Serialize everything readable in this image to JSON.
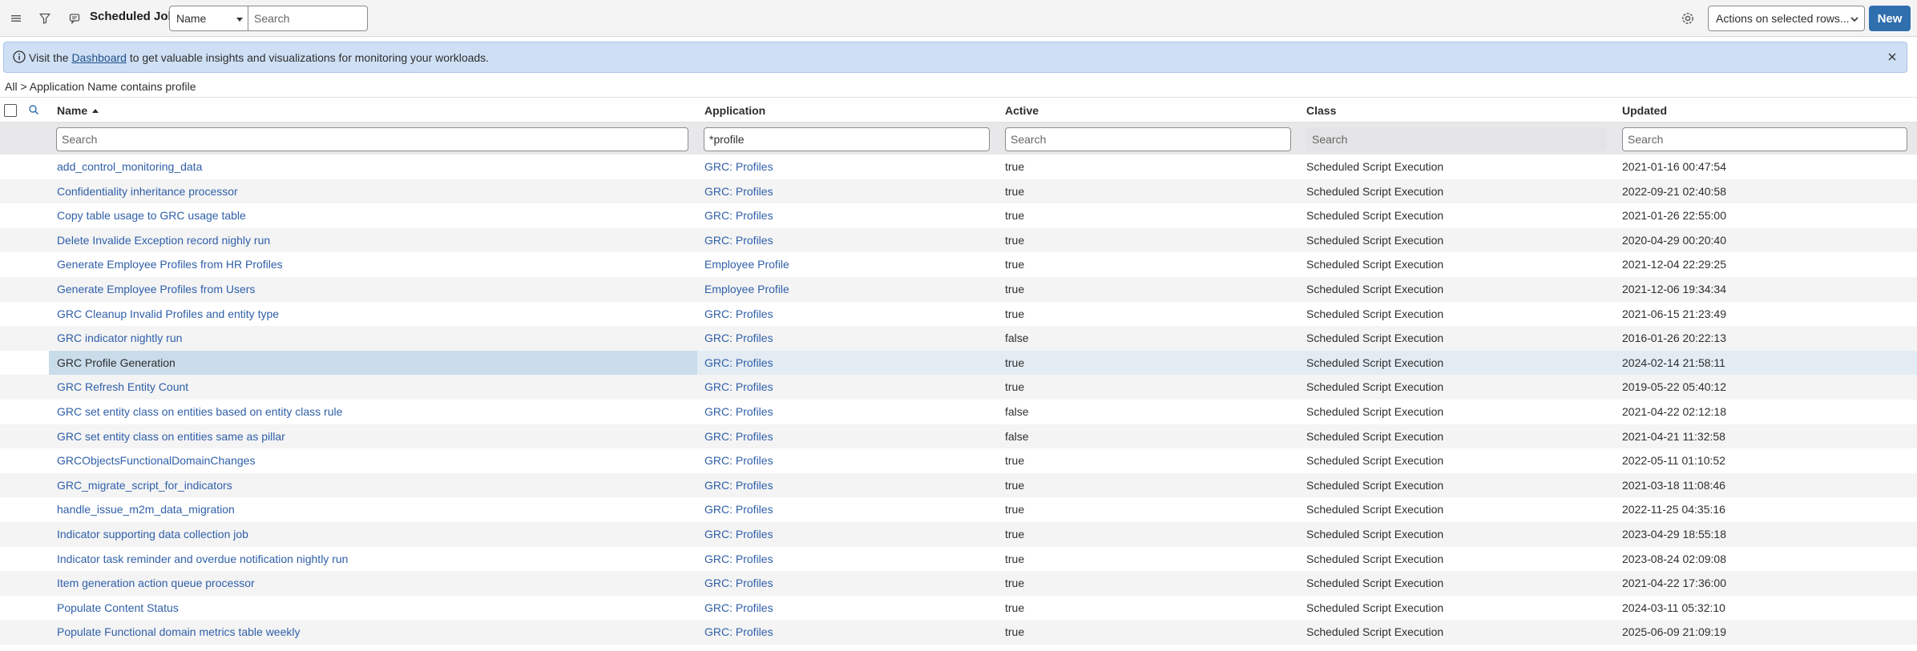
{
  "header": {
    "title": "Scheduled Jobs",
    "field_select": "Name",
    "search_placeholder": "Search",
    "actions_select": "Actions on selected rows...",
    "new_label": "New",
    "icons": [
      "hamburger-icon",
      "filter-icon",
      "chat-icon",
      "settings-icon"
    ]
  },
  "banner": {
    "prefix": "Visit the ",
    "link": "Dashboard",
    "suffix": " to get valuable insights and visualizations for monitoring your workloads."
  },
  "breadcrumb": "All > Application Name contains profile",
  "table": {
    "columns": {
      "name": "Name",
      "application": "Application",
      "active": "Active",
      "class": "Class",
      "updated": "Updated"
    },
    "filters": {
      "name_placeholder": "Search",
      "application_value": "*profile",
      "active_placeholder": "Search",
      "class_placeholder": "Search",
      "updated_placeholder": "Search"
    },
    "rows": [
      {
        "name": "add_control_monitoring_data",
        "application": "GRC: Profiles",
        "active": "true",
        "class": "Scheduled Script Execution",
        "updated": "2021-01-16 00:47:54"
      },
      {
        "name": "Confidentiality inheritance processor",
        "application": "GRC: Profiles",
        "active": "true",
        "class": "Scheduled Script Execution",
        "updated": "2022-09-21 02:40:58"
      },
      {
        "name": "Copy table usage to GRC usage table",
        "application": "GRC: Profiles",
        "active": "true",
        "class": "Scheduled Script Execution",
        "updated": "2021-01-26 22:55:00"
      },
      {
        "name": "Delete Invalide Exception record nighly run",
        "application": "GRC: Profiles",
        "active": "true",
        "class": "Scheduled Script Execution",
        "updated": "2020-04-29 00:20:40"
      },
      {
        "name": "Generate Employee Profiles from HR Profiles",
        "application": "Employee Profile",
        "active": "true",
        "class": "Scheduled Script Execution",
        "updated": "2021-12-04 22:29:25"
      },
      {
        "name": "Generate Employee Profiles from Users",
        "application": "Employee Profile",
        "active": "true",
        "class": "Scheduled Script Execution",
        "updated": "2021-12-06 19:34:34"
      },
      {
        "name": "GRC Cleanup Invalid Profiles and entity type",
        "application": "GRC: Profiles",
        "active": "true",
        "class": "Scheduled Script Execution",
        "updated": "2021-06-15 21:23:49"
      },
      {
        "name": "GRC indicator nightly run",
        "application": "GRC: Profiles",
        "active": "false",
        "class": "Scheduled Script Execution",
        "updated": "2016-01-26 20:22:13"
      },
      {
        "name": "GRC Profile Generation",
        "application": "GRC: Profiles",
        "active": "true",
        "class": "Scheduled Script Execution",
        "updated": "2024-02-14 21:58:11",
        "selected": true
      },
      {
        "name": "GRC Refresh Entity Count",
        "application": "GRC: Profiles",
        "active": "true",
        "class": "Scheduled Script Execution",
        "updated": "2019-05-22 05:40:12"
      },
      {
        "name": "GRC set entity class on entities based on entity class rule",
        "application": "GRC: Profiles",
        "active": "false",
        "class": "Scheduled Script Execution",
        "updated": "2021-04-22 02:12:18"
      },
      {
        "name": "GRC set entity class on entities same as pillar",
        "application": "GRC: Profiles",
        "active": "false",
        "class": "Scheduled Script Execution",
        "updated": "2021-04-21 11:32:58"
      },
      {
        "name": "GRCObjectsFunctionalDomainChanges",
        "application": "GRC: Profiles",
        "active": "true",
        "class": "Scheduled Script Execution",
        "updated": "2022-05-11 01:10:52"
      },
      {
        "name": "GRC_migrate_script_for_indicators",
        "application": "GRC: Profiles",
        "active": "true",
        "class": "Scheduled Script Execution",
        "updated": "2021-03-18 11:08:46"
      },
      {
        "name": "handle_issue_m2m_data_migration",
        "application": "GRC: Profiles",
        "active": "true",
        "class": "Scheduled Script Execution",
        "updated": "2022-11-25 04:35:16"
      },
      {
        "name": "Indicator supporting data collection job",
        "application": "GRC: Profiles",
        "active": "true",
        "class": "Scheduled Script Execution",
        "updated": "2023-04-29 18:55:18"
      },
      {
        "name": "Indicator task reminder and overdue notification nightly run",
        "application": "GRC: Profiles",
        "active": "true",
        "class": "Scheduled Script Execution",
        "updated": "2023-08-24 02:09:08"
      },
      {
        "name": "Item generation action queue processor",
        "application": "GRC: Profiles",
        "active": "true",
        "class": "Scheduled Script Execution",
        "updated": "2021-04-22 17:36:00"
      },
      {
        "name": "Populate Content Status",
        "application": "GRC: Profiles",
        "active": "true",
        "class": "Scheduled Script Execution",
        "updated": "2024-03-11 05:32:10"
      },
      {
        "name": "Populate Functional domain metrics table weekly",
        "application": "GRC: Profiles",
        "active": "true",
        "class": "Scheduled Script Execution",
        "updated": "2025-06-09 21:09:19"
      }
    ]
  }
}
